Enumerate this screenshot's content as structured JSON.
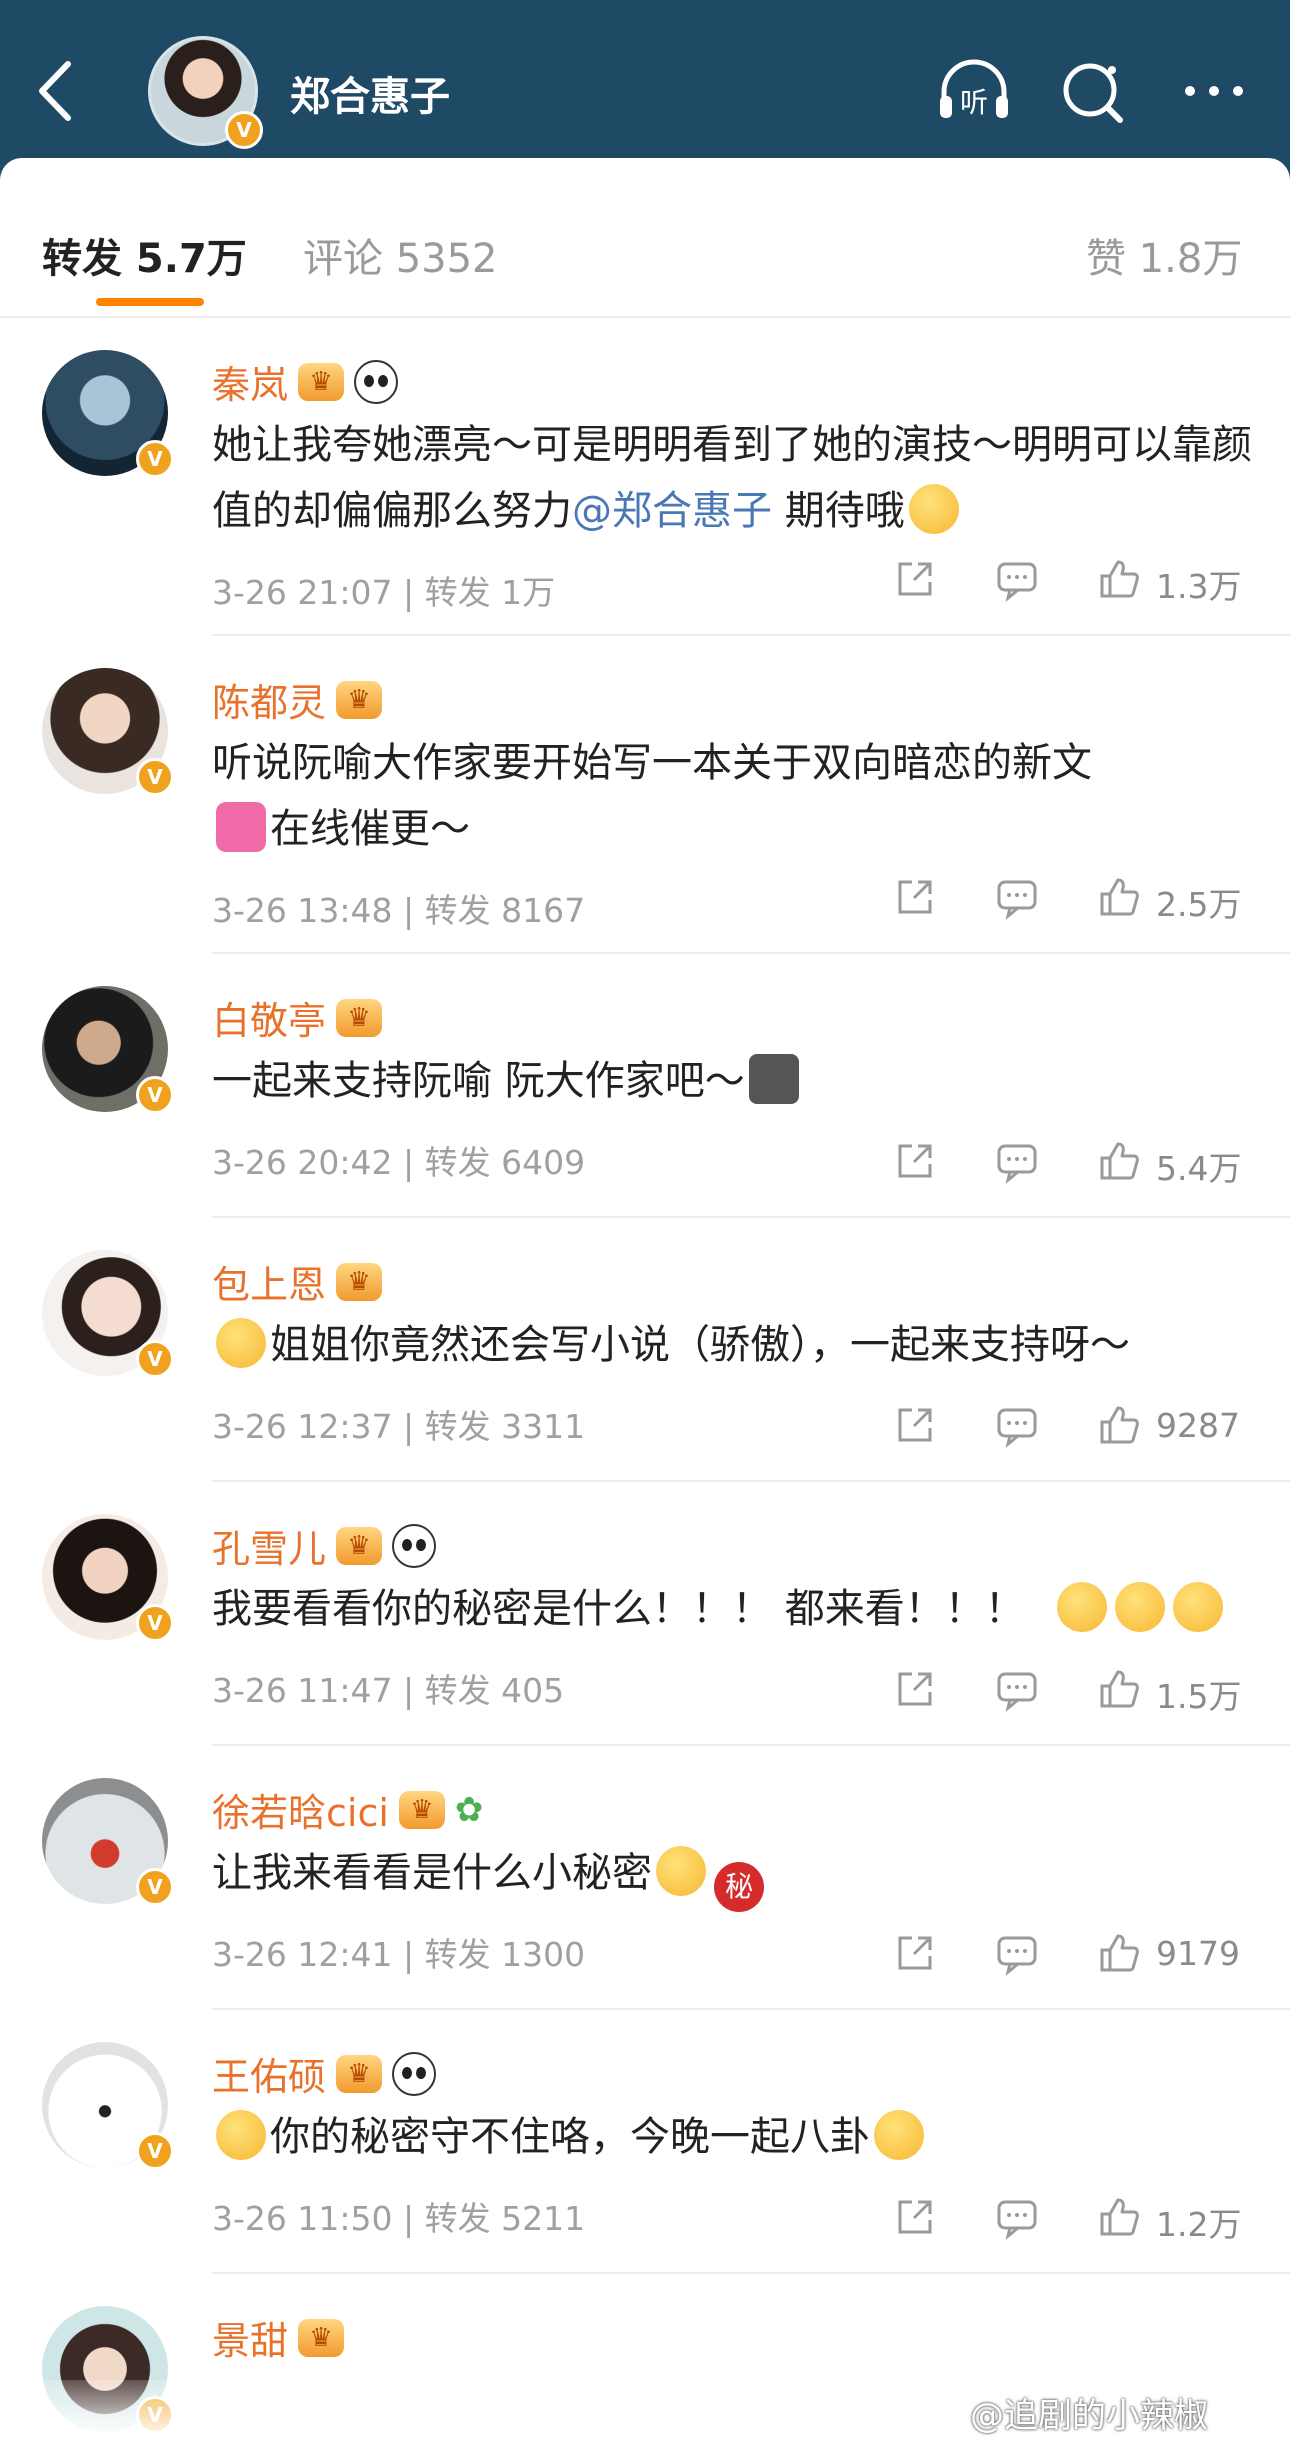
{
  "header": {
    "title": "郑合惠子",
    "verified": "V",
    "icons": [
      "back-icon",
      "listen-icon",
      "search-icon",
      "more-icon"
    ],
    "listen_label": "听"
  },
  "tabs": [
    {
      "label": "转发 5.7万"
    },
    {
      "label": "评论 5352"
    },
    {
      "label": "赞 1.8万"
    }
  ],
  "comments": [
    {
      "name": "秦岚",
      "text_a": "她让我夸她漂亮～可是明明看到了她的演技～明明可以靠颜值的却偏偏那么努力",
      "mention": "@郑合惠子",
      "text_b": "  期待哦",
      "time": "3-26 21:07",
      "repost": "转发 1万",
      "likes": "1.3万"
    },
    {
      "name": "陈都灵",
      "text_a": "听说阮喻大作家要开始写一本关于双向暗恋的新文",
      "text_b": "在线催更～",
      "time": "3-26 13:48",
      "repost": "转发 8167",
      "likes": "2.5万"
    },
    {
      "name": "白敬亭",
      "text_a": "一起来支持阮喻 阮大作家吧～",
      "time": "3-26 20:42",
      "repost": "转发 6409",
      "likes": "5.4万"
    },
    {
      "name": "包上恩",
      "text_a": "姐姐你竟然还会写小说（骄傲），一起来支持呀～",
      "time": "3-26 12:37",
      "repost": "转发 3311",
      "likes": "9287"
    },
    {
      "name": "孔雪儿",
      "text_a": "我要看看你的秘密是什么！！！ 都来看！！！",
      "time": "3-26 11:47",
      "repost": "转发 405",
      "likes": "1.5万"
    },
    {
      "name": "徐若晗cici",
      "text_a": "让我来看看是什么小秘密",
      "emoji_label": "秘",
      "time": "3-26 12:41",
      "repost": "转发 1300",
      "likes": "9179"
    },
    {
      "name": "王佑硕",
      "text_a": "你的秘密守不住咯，今晚一起八卦",
      "time": "3-26 11:50",
      "repost": "转发 5211",
      "likes": "1.2万"
    },
    {
      "name": "景甜"
    }
  ],
  "watermark": "@追剧的小辣椒",
  "colors": {
    "header_bg": "#1f4a66",
    "accent": "#ff8200",
    "name": "#e8722c",
    "mention": "#4a78b5"
  }
}
